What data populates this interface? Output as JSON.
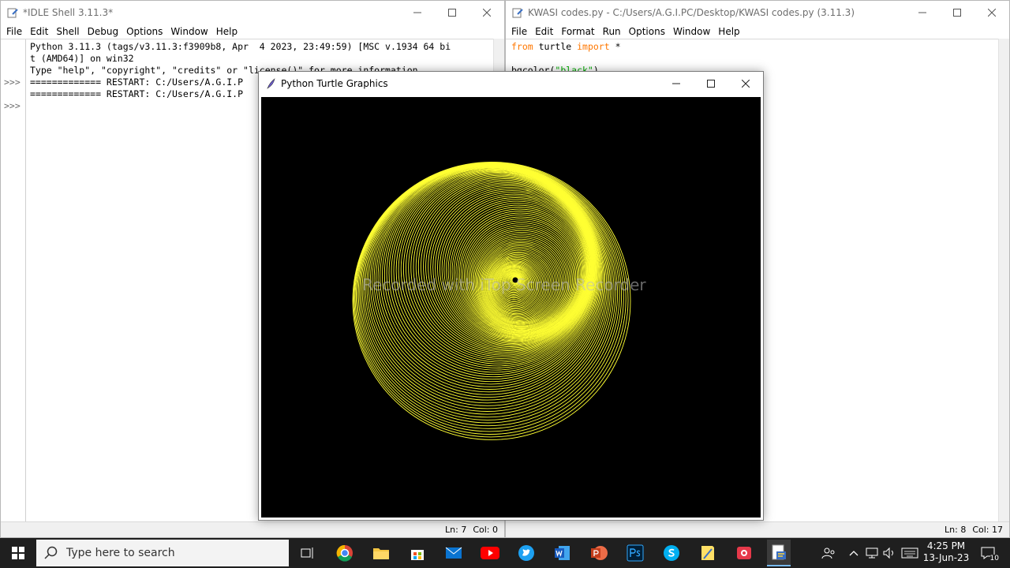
{
  "shell": {
    "title": "*IDLE Shell 3.11.3*",
    "menu": [
      "File",
      "Edit",
      "Shell",
      "Debug",
      "Options",
      "Window",
      "Help"
    ],
    "prompts": [
      ">>>",
      ">>>"
    ],
    "lines": [
      "Python 3.11.3 (tags/v3.11.3:f3909b8, Apr  4 2023, 23:49:59) [MSC v.1934 64 bi",
      "t (AMD64)] on win32",
      "Type \"help\", \"copyright\", \"credits\" or \"license()\" for more information.",
      "",
      "============= RESTART: C:/Users/A.G.I.P",
      "",
      "============= RESTART: C:/Users/A.G.I.P"
    ],
    "status": {
      "ln": "Ln: 7",
      "col": "Col: 0"
    }
  },
  "editor": {
    "title": "KWASI codes.py - C:/Users/A.G.I.PC/Desktop/KWASI codes.py (3.11.3)",
    "menu": [
      "File",
      "Edit",
      "Format",
      "Run",
      "Options",
      "Window",
      "Help"
    ],
    "code": {
      "kw_from": "from",
      "module": " turtle ",
      "kw_import": "import",
      "star": " *",
      "call": "bgcolor(",
      "arg": "\"black\"",
      "close": ")"
    },
    "status": {
      "ln": "Ln: 8",
      "col": "Col: 17"
    }
  },
  "turtle": {
    "title": "Python Turtle Graphics",
    "watermark": "Recorded with iTop Screen Recorder",
    "pen_color": "#ffff33",
    "background": "#000000"
  },
  "taskbar": {
    "search_placeholder": "Type here to search",
    "time": "4:25 PM",
    "date": "13-Jun-23",
    "notification_count": "10"
  },
  "colors": {
    "keyword": "#ff7700",
    "string": "#00aa00",
    "taskbar": "#1f1f1f"
  }
}
